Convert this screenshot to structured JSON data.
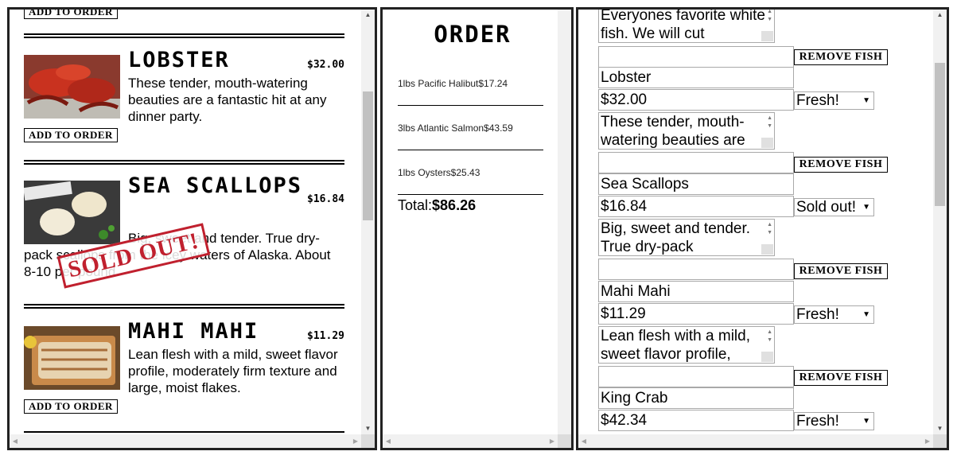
{
  "menu": {
    "add_label": "ADD TO ORDER",
    "sold_out_label": "SOLD OUT!",
    "items": [
      {
        "name": "LOBSTER",
        "price": "$32.00",
        "desc": "These tender, mouth-watering beauties are a fantastic hit at any dinner party."
      },
      {
        "name": "SEA SCALLOPS",
        "price": "$16.84",
        "desc": "Big, sweet and tender. True dry-pack scallops from the icey waters of Alaska. About 8-10 per pound"
      },
      {
        "name": "MAHI MAHI",
        "price": "$11.29",
        "desc": "Lean flesh with a mild, sweet flavor profile, moderately firm texture and large, moist flakes."
      }
    ]
  },
  "order": {
    "title": "ORDER",
    "lines": [
      "1lbs Pacific Halibut$17.24",
      "3lbs Atlantic Salmon$43.59",
      "1lbs Oysters$25.43"
    ],
    "total_label": "Total:",
    "total_value": "$86.26"
  },
  "inventory": {
    "top_desc": "Everyones favorite white fish. We will cut",
    "remove_label": "REMOVE FISH",
    "items": [
      {
        "name": "Lobster",
        "price": "$32.00",
        "status": "Fresh!",
        "desc": "These tender, mouth-watering beauties are"
      },
      {
        "name": "Sea Scallops",
        "price": "$16.84",
        "status": "Sold out!",
        "desc": "Big, sweet and tender. True dry-pack"
      },
      {
        "name": "Mahi Mahi",
        "price": "$11.29",
        "status": "Fresh!",
        "desc": "Lean flesh with a mild, sweet flavor profile,"
      },
      {
        "name": "King Crab",
        "price": "$42.34",
        "status": "Fresh!"
      }
    ]
  },
  "colors": {
    "sold_out": "#c0202e",
    "border": "#222222"
  }
}
